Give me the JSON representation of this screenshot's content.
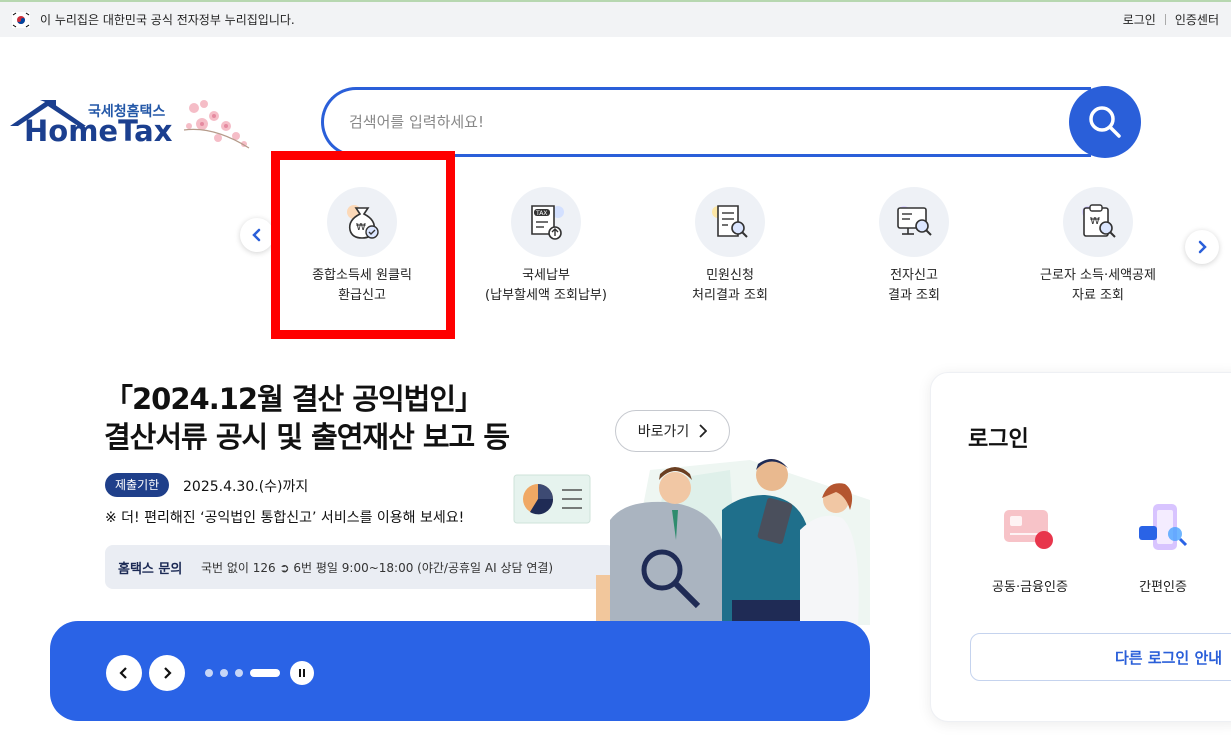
{
  "gov_bar": {
    "notice": "이 누리집은 대한민국 공식 전자정부 누리집입니다.",
    "links": [
      "로그인",
      "인증센터"
    ]
  },
  "logo": {
    "subtitle": "국세청홈택스",
    "title": "HomeTax"
  },
  "search": {
    "placeholder": "검색어를 입력하세요!",
    "value": ""
  },
  "quick_menu": {
    "items": [
      {
        "line1": "종합소득세 원클릭",
        "line2": "환급신고",
        "icon": "money-bag-check-icon"
      },
      {
        "line1": "국세납부",
        "line2": "(납부할세액 조회납부)",
        "icon": "tax-document-upload-icon"
      },
      {
        "line1": "민원신청",
        "line2": "처리결과 조회",
        "icon": "document-search-icon"
      },
      {
        "line1": "전자신고",
        "line2": "결과 조회",
        "icon": "monitor-search-icon"
      },
      {
        "line1": "근로자 소득·세액공제",
        "line2": "자료 조회",
        "icon": "clipboard-search-icon"
      }
    ]
  },
  "banner": {
    "title_line1": "「2024.12월 결산 공익법인」",
    "title_line2": "결산서류 공시 및 출연재산 보고 등",
    "goto_label": "바로가기",
    "deadline_badge": "제출기한",
    "deadline_text": "2025.4.30.(수)까지",
    "notice": "※ 더! 편리해진 ‘공익법인 통합신고’ 서비스를 이용해 보세요!",
    "inquiry_label": "홈택스 문의",
    "inquiry_text": "국번 없이 126 ➲ 6번 평일 9:00~18:00 (야간/공휴일 AI 상담 연결)"
  },
  "slider": {
    "total_dots": 4,
    "active_index": 3
  },
  "login": {
    "title": "로그인",
    "options": [
      {
        "label": "공동·금융인증",
        "icon": "certificate-card-icon"
      },
      {
        "label": "간편인증",
        "icon": "phone-auth-icon"
      }
    ],
    "other_label": "다른 로그인 안내"
  },
  "colors": {
    "primary": "#2a5fd9",
    "banner_blue": "#2a63e6",
    "navy": "#1f3f8a",
    "highlight": "#ff0000"
  }
}
